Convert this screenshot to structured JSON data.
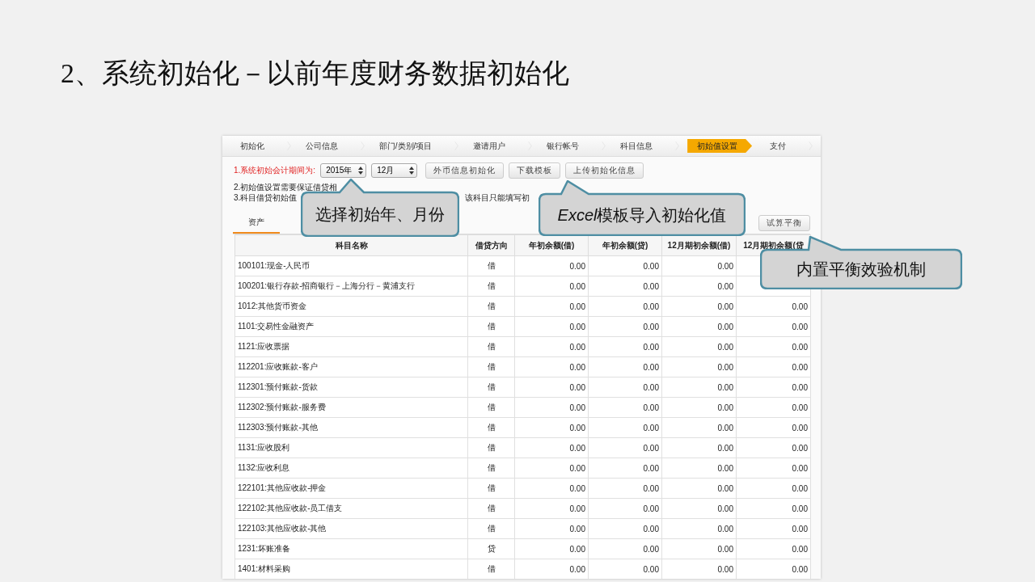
{
  "title": "2、系统初始化－以前年度财务数据初始化",
  "steps": [
    {
      "label": "初始化",
      "selected": false
    },
    {
      "label": "公司信息",
      "selected": false
    },
    {
      "label": "部门/类别/项目",
      "selected": false
    },
    {
      "label": "邀请用户",
      "selected": false
    },
    {
      "label": "银行帐号",
      "selected": false
    },
    {
      "label": "科目信息",
      "selected": false
    },
    {
      "label": "初始值设置",
      "selected": true
    },
    {
      "label": "支付",
      "selected": false
    }
  ],
  "period": {
    "label": "1.系统初始会计期间为:",
    "year": "2015年",
    "month": "12月"
  },
  "buttons": [
    "外币信息初始化",
    "下载模板",
    "上传初始化信息"
  ],
  "notes": [
    [
      "2.初始值设置需要保证借贷相"
    ],
    [
      "3.科目借贷初始值",
      "该科目只能填写初"
    ]
  ],
  "tabs": [
    {
      "label": "资产",
      "selected": true
    }
  ],
  "check_button": "试算平衡",
  "table": {
    "columns": [
      "科目名称",
      "借贷方向",
      "年初余额(借)",
      "年初余额(贷)",
      "12月期初余额(借)",
      "12月期初余额(贷"
    ],
    "rows": [
      [
        "100101:现金-人民币",
        "借",
        "0.00",
        "0.00",
        "0.00"
      ],
      [
        "100201:银行存款-招商银行－上海分行－黄浦支行",
        "借",
        "0.00",
        "0.00",
        "0.00"
      ],
      [
        "1012:其他货币资金",
        "借",
        "0.00",
        "0.00",
        "0.00",
        "0.00"
      ],
      [
        "1101:交易性金融资产",
        "借",
        "0.00",
        "0.00",
        "0.00",
        "0.00"
      ],
      [
        "1121:应收票据",
        "借",
        "0.00",
        "0.00",
        "0.00",
        "0.00"
      ],
      [
        "112201:应收账款-客户",
        "借",
        "0.00",
        "0.00",
        "0.00",
        "0.00"
      ],
      [
        "112301:预付账款-货款",
        "借",
        "0.00",
        "0.00",
        "0.00",
        "0.00"
      ],
      [
        "112302:预付账款-服务费",
        "借",
        "0.00",
        "0.00",
        "0.00",
        "0.00"
      ],
      [
        "112303:预付账款-其他",
        "借",
        "0.00",
        "0.00",
        "0.00",
        "0.00"
      ],
      [
        "1131:应收股利",
        "借",
        "0.00",
        "0.00",
        "0.00",
        "0.00"
      ],
      [
        "1132:应收利息",
        "借",
        "0.00",
        "0.00",
        "0.00",
        "0.00"
      ],
      [
        "122101:其他应收款-押金",
        "借",
        "0.00",
        "0.00",
        "0.00",
        "0.00"
      ],
      [
        "122102:其他应收款-员工借支",
        "借",
        "0.00",
        "0.00",
        "0.00",
        "0.00"
      ],
      [
        "122103:其他应收款-其他",
        "借",
        "0.00",
        "0.00",
        "0.00",
        "0.00"
      ],
      [
        "1231:坏账准备",
        "贷",
        "0.00",
        "0.00",
        "0.00",
        "0.00"
      ],
      [
        "1401:材料采购",
        "借",
        "0.00",
        "0.00",
        "0.00",
        "0.00"
      ]
    ]
  },
  "callouts": [
    {
      "text": "选择初始年、月份"
    },
    {
      "lead": "Excel",
      "text": "模板导入初始化值"
    },
    {
      "text": "内置平衡效验机制"
    }
  ]
}
